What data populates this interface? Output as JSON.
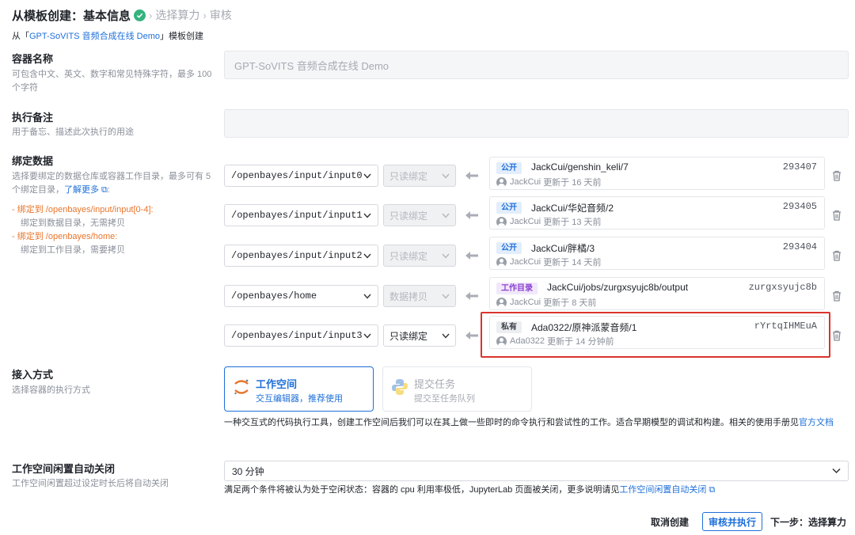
{
  "header": {
    "step1": "从模板创建：基本信息",
    "step2": "选择算力",
    "step3": "审核",
    "subtitle_prefix": "从「",
    "subtitle_link": "GPT-SoVITS 音频合成在线 Demo",
    "subtitle_suffix": "」模板创建"
  },
  "container_name": {
    "title": "容器名称",
    "desc": "可包含中文、英文、数字和常见特殊字符，最多 100 个字符",
    "value": "GPT-SoVITS 音频合成在线 Demo"
  },
  "note": {
    "title": "执行备注",
    "desc": "用于备忘、描述此次执行的用途",
    "value": ""
  },
  "binding": {
    "title": "绑定数据",
    "desc": "选择要绑定的数据仓库或容器工作目录，最多可有 5 个绑定目录，",
    "learn_more": "了解更多",
    "rule1": "绑定到 /openbayes/input/input[0-4]:",
    "rule1_desc": "绑定到数据目录，无需拷贝",
    "rule2": "绑定到 /openbayes/home:",
    "rule2_desc": "绑定到工作目录，需要拷贝",
    "rows": [
      {
        "path": "/openbayes/input/input0",
        "mode": "只读绑定",
        "tag": "公开",
        "name": "JackCui/genshin_keli/7",
        "id": "293407",
        "owner": "JackCui",
        "updated": "更新于 16 天前"
      },
      {
        "path": "/openbayes/input/input1",
        "mode": "只读绑定",
        "tag": "公开",
        "name": "JackCui/华妃音频/2",
        "id": "293405",
        "owner": "JackCui",
        "updated": "更新于 13 天前"
      },
      {
        "path": "/openbayes/input/input2",
        "mode": "只读绑定",
        "tag": "公开",
        "name": "JackCui/胖橘/3",
        "id": "293404",
        "owner": "JackCui",
        "updated": "更新于 14 天前"
      },
      {
        "path": "/openbayes/home",
        "mode": "数据拷贝",
        "tag": "工作目录",
        "name": "JackCui/jobs/zurgxsyujc8b/output",
        "id": "zurgxsyujc8b",
        "owner": "JackCui",
        "updated": "更新于 8 天前"
      },
      {
        "path": "/openbayes/input/input3",
        "mode": "只读绑定",
        "tag": "私有",
        "name": "Ada0322/原神派蒙音频/1",
        "id": "rYrtqIHMEuA",
        "owner": "Ada0322",
        "updated": "更新于 14 分钟前"
      }
    ]
  },
  "access": {
    "title": "接入方式",
    "desc": "选择容器的执行方式",
    "workspace_title": "工作空间",
    "workspace_sub": "交互编辑器，推荐使用",
    "task_title": "提交任务",
    "task_sub": "提交至任务队列",
    "explain": "一种交互式的代码执行工具，创建工作空间后我们可以在其上做一些即时的命令执行和尝试性的工作。适合早期模型的调试和构建。相关的使用手册见",
    "explain_link": "官方文档"
  },
  "idle": {
    "title": "工作空间闲置自动关闭",
    "desc": "工作空间闲置超过设定时长后将自动关闭",
    "value": "30 分钟",
    "explain": "满足两个条件将被认为处于空闲状态：容器的 cpu 利用率极低，JupyterLab 页面被关闭，更多说明请见",
    "explain_link": "工作空间闲置自动关闭"
  },
  "footer": {
    "cancel": "取消创建",
    "review": "审核并执行",
    "next": "下一步：选择算力"
  },
  "colors": {
    "accent": "#1e6fd9",
    "success": "#36b37e",
    "highlight": "#d9342b",
    "orange": "#e8752c"
  }
}
